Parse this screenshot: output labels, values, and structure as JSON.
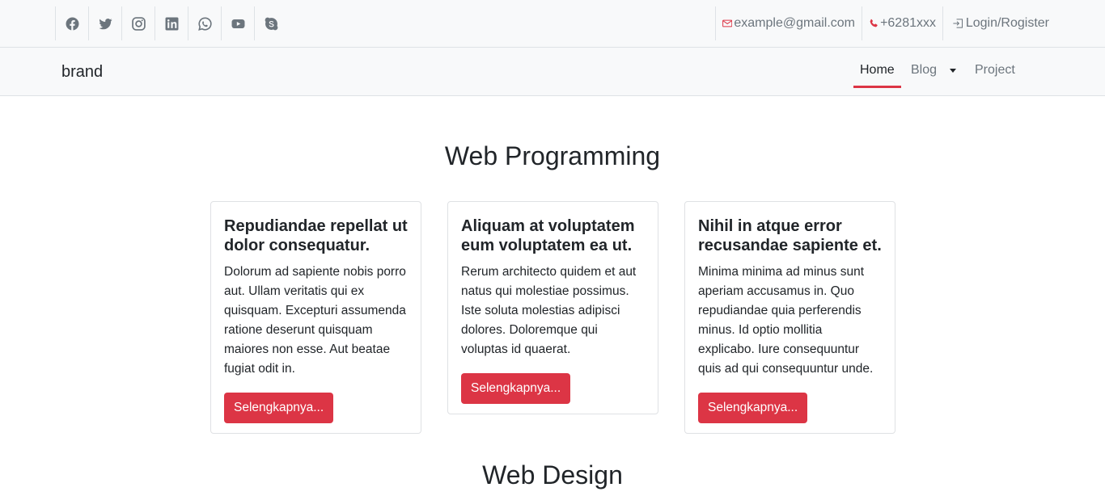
{
  "topbar": {
    "socials": [
      {
        "icon": "facebook-icon"
      },
      {
        "icon": "twitter-icon"
      },
      {
        "icon": "instagram-icon"
      },
      {
        "icon": "linkedin-icon"
      },
      {
        "icon": "whatsapp-icon"
      },
      {
        "icon": "youtube-icon"
      },
      {
        "icon": "skype-icon"
      }
    ],
    "email": "example@gmail.com",
    "phone": "+6281xxx",
    "login": "Login/Rogister",
    "colors": {
      "email_icon": "#dc3545",
      "phone_icon": "#dc3545",
      "social_icon": "#6c757d"
    }
  },
  "navbar": {
    "brand": "brand",
    "items": [
      {
        "label": "Home",
        "active": true
      },
      {
        "label": "Blog",
        "dropdown": true
      },
      {
        "label": "Project"
      }
    ],
    "accent": "#dc3545"
  },
  "sections": [
    {
      "title": "Web Programming",
      "cards": [
        {
          "title": "Repudiandae repellat ut dolor consequatur.",
          "text": "Dolorum ad sapiente nobis porro aut. Ullam veritatis qui ex quisquam. Excepturi assumenda ratione deserunt quisquam maiores non esse. Aut beatae fugiat odit in.",
          "button": "Selengkapnya..."
        },
        {
          "title": "Aliquam at voluptatem eum voluptatem ea ut.",
          "text": "Rerum architecto quidem et aut natus qui molestiae possimus. Iste soluta molestias adipisci dolores. Doloremque qui voluptas id quaerat.",
          "button": "Selengkapnya..."
        },
        {
          "title": "Nihil in atque error recusandae sapiente et.",
          "text": "Minima minima ad minus sunt aperiam accusamus in. Quo repudiandae quia perferendis minus. Id optio mollitia explicabo. Iure consequuntur quis ad qui consequuntur unde.",
          "button": "Selengkapnya..."
        }
      ]
    },
    {
      "title": "Web Design"
    }
  ]
}
